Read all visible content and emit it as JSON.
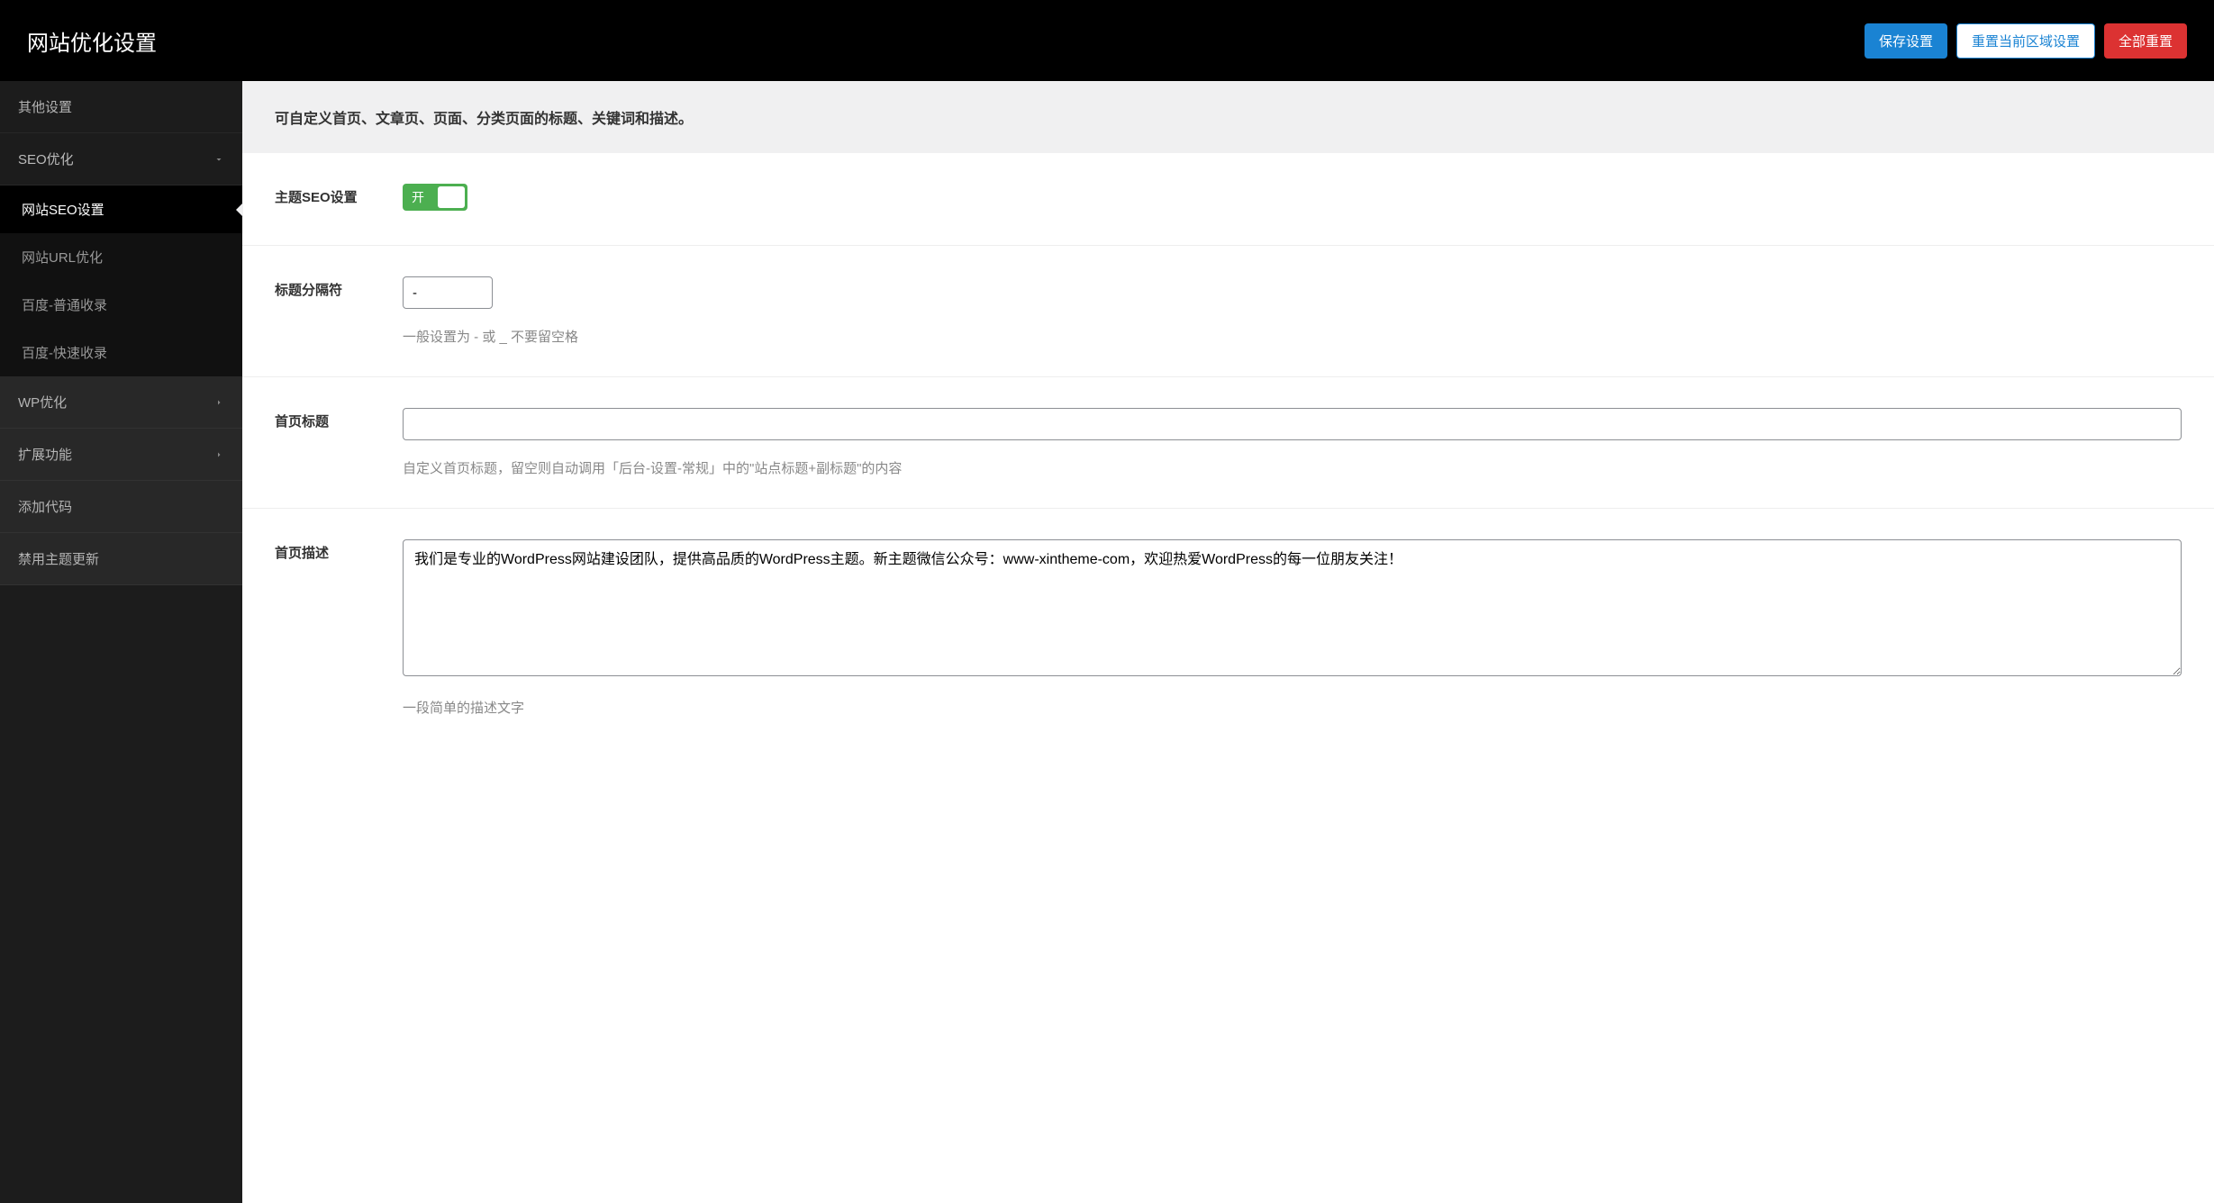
{
  "header": {
    "title": "网站优化设置",
    "actions": {
      "save": "保存设置",
      "reset_section": "重置当前区域设置",
      "reset_all": "全部重置"
    }
  },
  "sidebar": {
    "items": [
      {
        "label": "其他设置",
        "type": "item"
      },
      {
        "label": "SEO优化",
        "type": "expanded",
        "children": [
          {
            "label": "网站SEO设置",
            "active": true
          },
          {
            "label": "网站URL优化"
          },
          {
            "label": "百度-普通收录"
          },
          {
            "label": "百度-快速收录"
          }
        ]
      },
      {
        "label": "WP优化",
        "type": "collapsible"
      },
      {
        "label": "扩展功能",
        "type": "collapsible"
      },
      {
        "label": "添加代码",
        "type": "item"
      },
      {
        "label": "禁用主题更新",
        "type": "item"
      }
    ]
  },
  "main": {
    "description": "可自定义首页、文章页、页面、分类页面的标题、关键词和描述。",
    "fields": {
      "theme_seo": {
        "label": "主题SEO设置",
        "toggle_on": "开"
      },
      "title_separator": {
        "label": "标题分隔符",
        "value": "-",
        "help": "一般设置为 - 或 _ 不要留空格"
      },
      "home_title": {
        "label": "首页标题",
        "value": "",
        "help": "自定义首页标题，留空则自动调用「后台-设置-常规」中的\"站点标题+副标题\"的内容"
      },
      "home_description": {
        "label": "首页描述",
        "value": "我们是专业的WordPress网站建设团队，提供高品质的WordPress主题。新主题微信公众号：www-xintheme-com，欢迎热爱WordPress的每一位朋友关注！",
        "help": "一段简单的描述文字"
      }
    }
  }
}
